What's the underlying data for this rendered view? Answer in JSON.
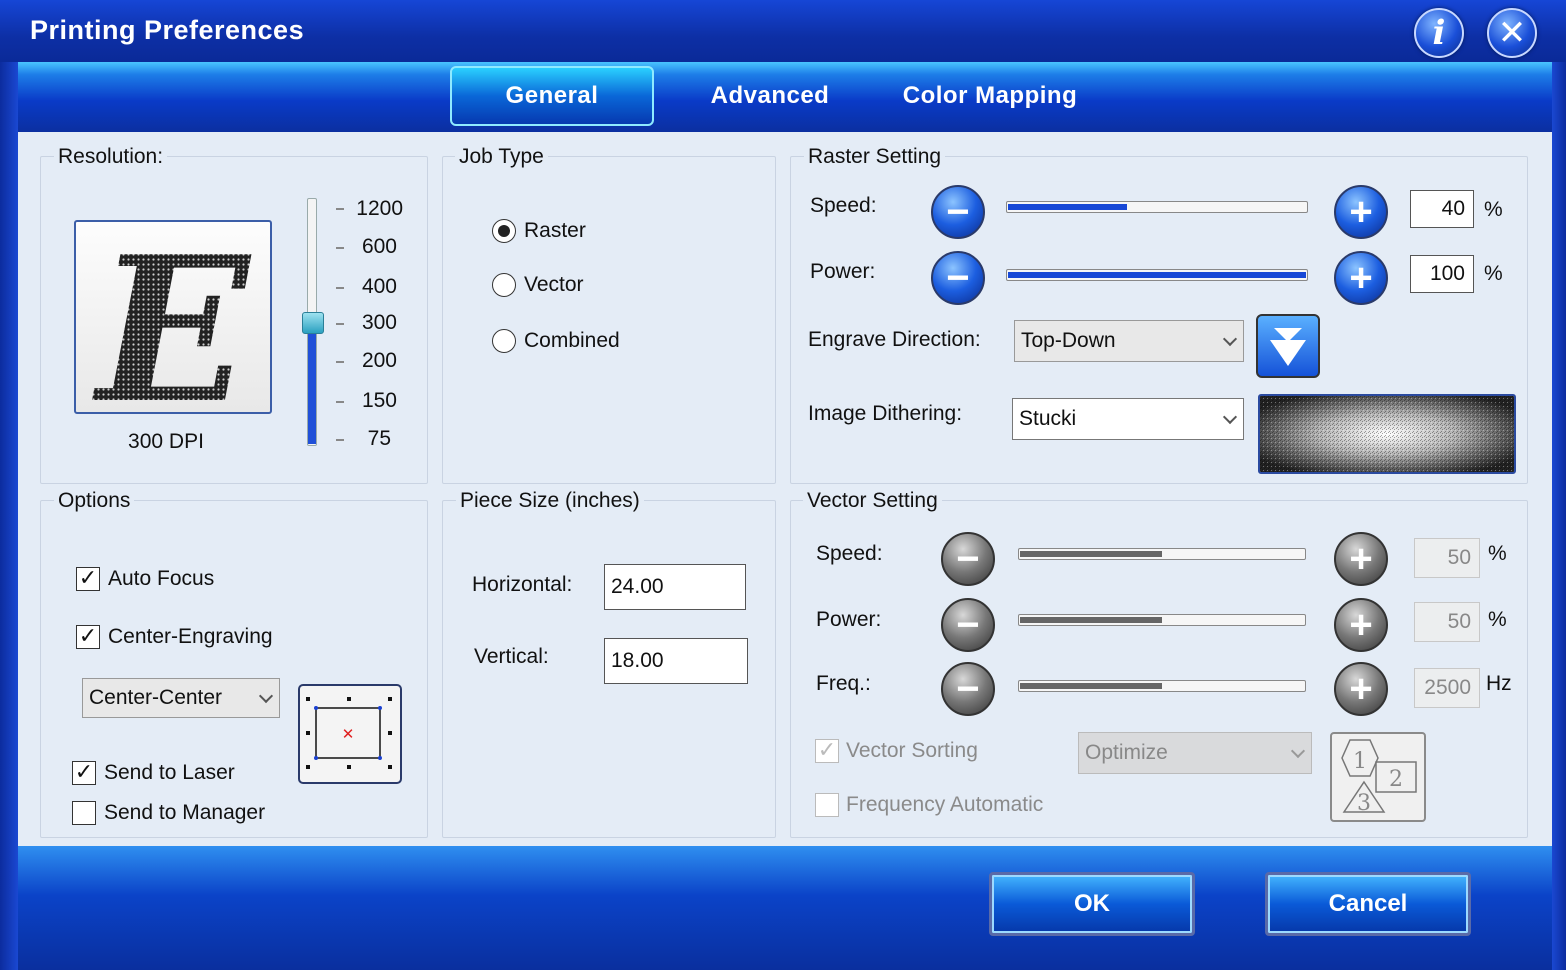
{
  "window": {
    "title": "Printing Preferences"
  },
  "tabs": {
    "general": "General",
    "advanced": "Advanced",
    "color_mapping": "Color Mapping"
  },
  "resolution": {
    "group_label": "Resolution:",
    "preview_letter": "E",
    "current": "300 DPI",
    "levels": [
      "1200",
      "600",
      "400",
      "300",
      "200",
      "150",
      "75"
    ],
    "selected_index": 3
  },
  "job_type": {
    "group_label": "Job Type",
    "options": [
      "Raster",
      "Vector",
      "Combined"
    ],
    "selected": "Raster"
  },
  "raster": {
    "group_label": "Raster Setting",
    "speed_label": "Speed:",
    "speed_value": "40",
    "speed_unit": "%",
    "speed_level": 0.4,
    "power_label": "Power:",
    "power_value": "100",
    "power_unit": "%",
    "power_level": 1.0,
    "engrave_label": "Engrave Direction:",
    "engrave_value": "Top-Down",
    "dither_label": "Image Dithering:",
    "dither_value": "Stucki"
  },
  "options": {
    "group_label": "Options",
    "auto_focus": "Auto Focus",
    "center_engraving": "Center-Engraving",
    "center_mode": "Center-Center",
    "send_to_laser": "Send to Laser",
    "send_to_manager": "Send to Manager"
  },
  "piece_size": {
    "group_label": "Piece Size (inches)",
    "horizontal_label": "Horizontal:",
    "horizontal_value": "24.00",
    "vertical_label": "Vertical:",
    "vertical_value": "18.00"
  },
  "vector": {
    "group_label": "Vector Setting",
    "speed_label": "Speed:",
    "speed_value": "50",
    "speed_unit": "%",
    "speed_level": 0.5,
    "power_label": "Power:",
    "power_value": "50",
    "power_unit": "%",
    "power_level": 0.5,
    "freq_label": "Freq.:",
    "freq_value": "2500",
    "freq_unit": "Hz",
    "freq_level": 0.5,
    "sorting_label": "Vector Sorting",
    "sorting_value": "Optimize",
    "freq_auto_label": "Frequency Automatic",
    "sort_icon_digits": [
      "1",
      "2",
      "3"
    ]
  },
  "buttons": {
    "ok": "OK",
    "cancel": "Cancel"
  },
  "colors": {
    "accent_blue": "#1748d6",
    "panel_bg": "#e4ecf6",
    "titlebar": "#0d2fa5"
  }
}
